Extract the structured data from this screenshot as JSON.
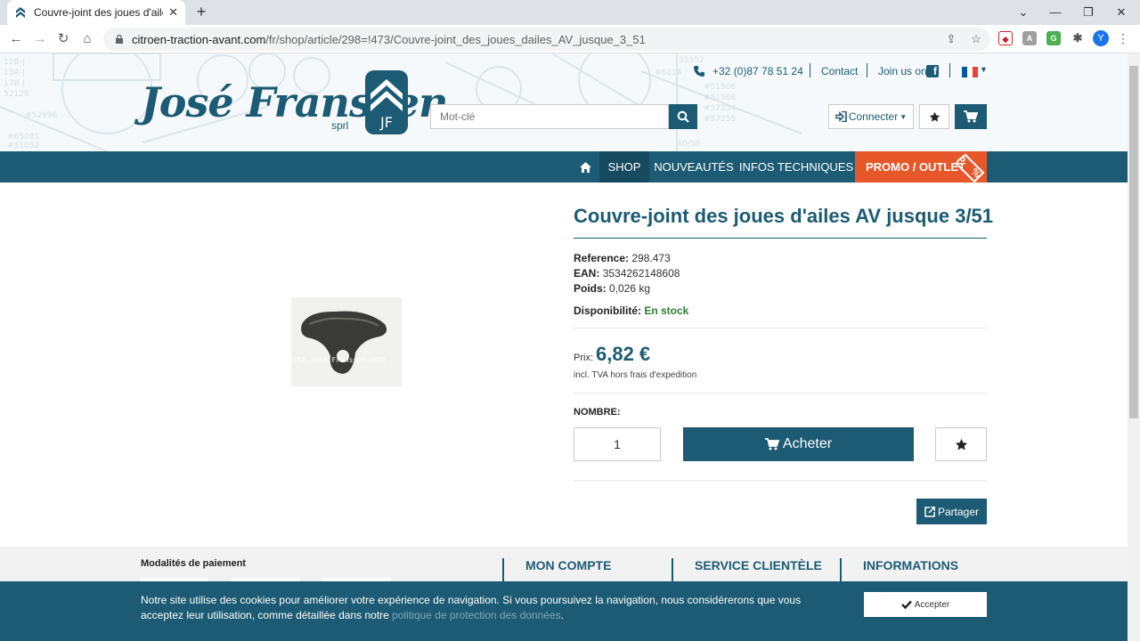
{
  "browser": {
    "tab_title": "Couvre-joint des joues d'ailes AV",
    "tab_close": "✕",
    "new_tab": "+",
    "url_host": "citroen-traction-avant.com",
    "url_path": "/fr/shop/article/298=!473/Couvre-joint_des_joues_dailes_AV_jusque_3_51",
    "profile_initial": "Y",
    "icons": [
      "back-icon",
      "forward-icon",
      "reload-icon",
      "home-icon",
      "lock-icon",
      "share-icon",
      "star-icon",
      "extensions-icon",
      "minimize-icon",
      "maximize-icon",
      "close-icon"
    ]
  },
  "header": {
    "logo_text": "José Franssen",
    "logo_sub": "sprl",
    "emblem_letters": "JF",
    "search_placeholder": "Mot-clé",
    "phone": "+32 (0)87 78 51 24",
    "contact": "Contact",
    "join": "Join us on",
    "connect_label": "Connecter",
    "brand_color": "#1c5b73",
    "promo_color": "#e8572a"
  },
  "nav": {
    "shop": "SHOP",
    "nouveautes": "NOUVEAUTÉS",
    "infos": "INFOS TECHNIQUES",
    "promo": "PROMO / OUTLET"
  },
  "product": {
    "title": "Couvre-joint des joues d'ailes AV jusque 3/51",
    "image_watermark": "©TA José Franssen SPRL",
    "reference_label": "Reference:",
    "reference": "298.473",
    "ean_label": "EAN:",
    "ean": "3534262148608",
    "poids_label": "Poids:",
    "poids": "0,026 kg",
    "dispo_label": "Disponibilité:",
    "dispo": "En stock",
    "prix_label": "Prix:",
    "prix": "6,82 €",
    "tva": "incl. TVA hors frais d'expedition",
    "nombre_label": "NOMBRE:",
    "quantity": "1",
    "buy_label": "Acheter",
    "share_label": "Partager"
  },
  "footer": {
    "payment": "Modalités de paiement",
    "col1": "MON COMPTE",
    "col2": "SERVICE CLIENTÈLE",
    "col3": "INFORMATIONS"
  },
  "cookie": {
    "text": "Notre site utilise des cookies pour améliorer votre expérience de navigation. Si vous poursuivez la navigation, nous considérerons que vous acceptez leur utilisation, comme détaillée dans notre ",
    "link": "politique de protection des données",
    "end": ".",
    "accept": "Accepter"
  }
}
